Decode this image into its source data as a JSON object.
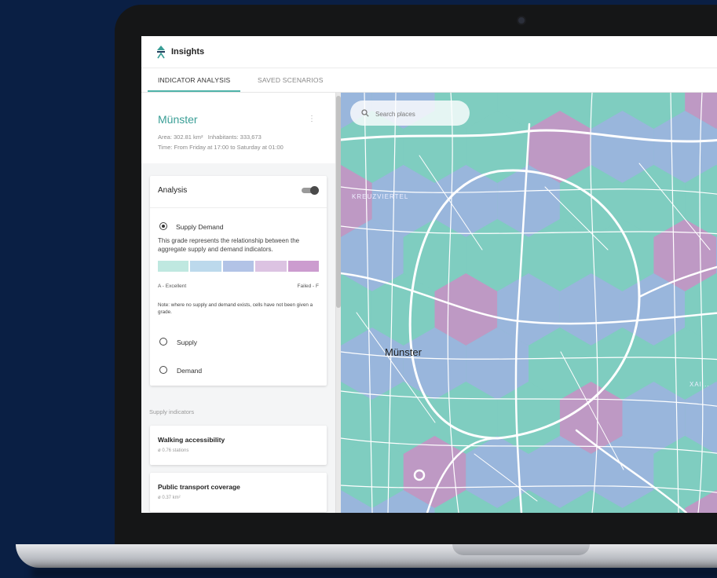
{
  "app": {
    "title": "Insights"
  },
  "tabs": [
    {
      "label": "INDICATOR ANALYSIS",
      "active": true
    },
    {
      "label": "SAVED SCENARIOS",
      "active": false
    }
  ],
  "city": {
    "name": "Münster",
    "area": "Area: 302.81 km²",
    "inhabitants": "Inhabitants: 333,673",
    "time": "Time: From Friday at 17:00 to Saturday at 01:00"
  },
  "analysis": {
    "title": "Analysis",
    "toggle_on": true,
    "options": [
      {
        "label": "Supply Demand",
        "selected": true
      },
      {
        "label": "Supply",
        "selected": false
      },
      {
        "label": "Demand",
        "selected": false
      }
    ],
    "description": "This grade represents the relationship between the aggregate supply and demand indicators.",
    "grade_colors": [
      "#bfe8e0",
      "#bcd9ec",
      "#b2c3e6",
      "#dcc3e2",
      "#cc9ccf"
    ],
    "grade_min": "A - Excellent",
    "grade_max": "Failed - F",
    "note": "Note: where no supply and demand exists, cells have not been given a grade."
  },
  "supply_indicators": {
    "label": "Supply indicators",
    "items": [
      {
        "title": "Walking accessibility",
        "value": "ø 0.76 stations"
      },
      {
        "title": "Public transport coverage",
        "value": "ø 0.37 km²"
      }
    ]
  },
  "map": {
    "search_placeholder": "Search places",
    "labels": {
      "city": "Münster",
      "district": "KREUZVIERTEL",
      "edge": "XAI..."
    },
    "colors": {
      "teal": "#7fcdbf",
      "blue": "#9eb2e0",
      "purple": "#c98fc4",
      "road": "#ffffff"
    }
  },
  "colors": {
    "accent": "#3a9e96",
    "screen_background": "#0a1f44"
  }
}
